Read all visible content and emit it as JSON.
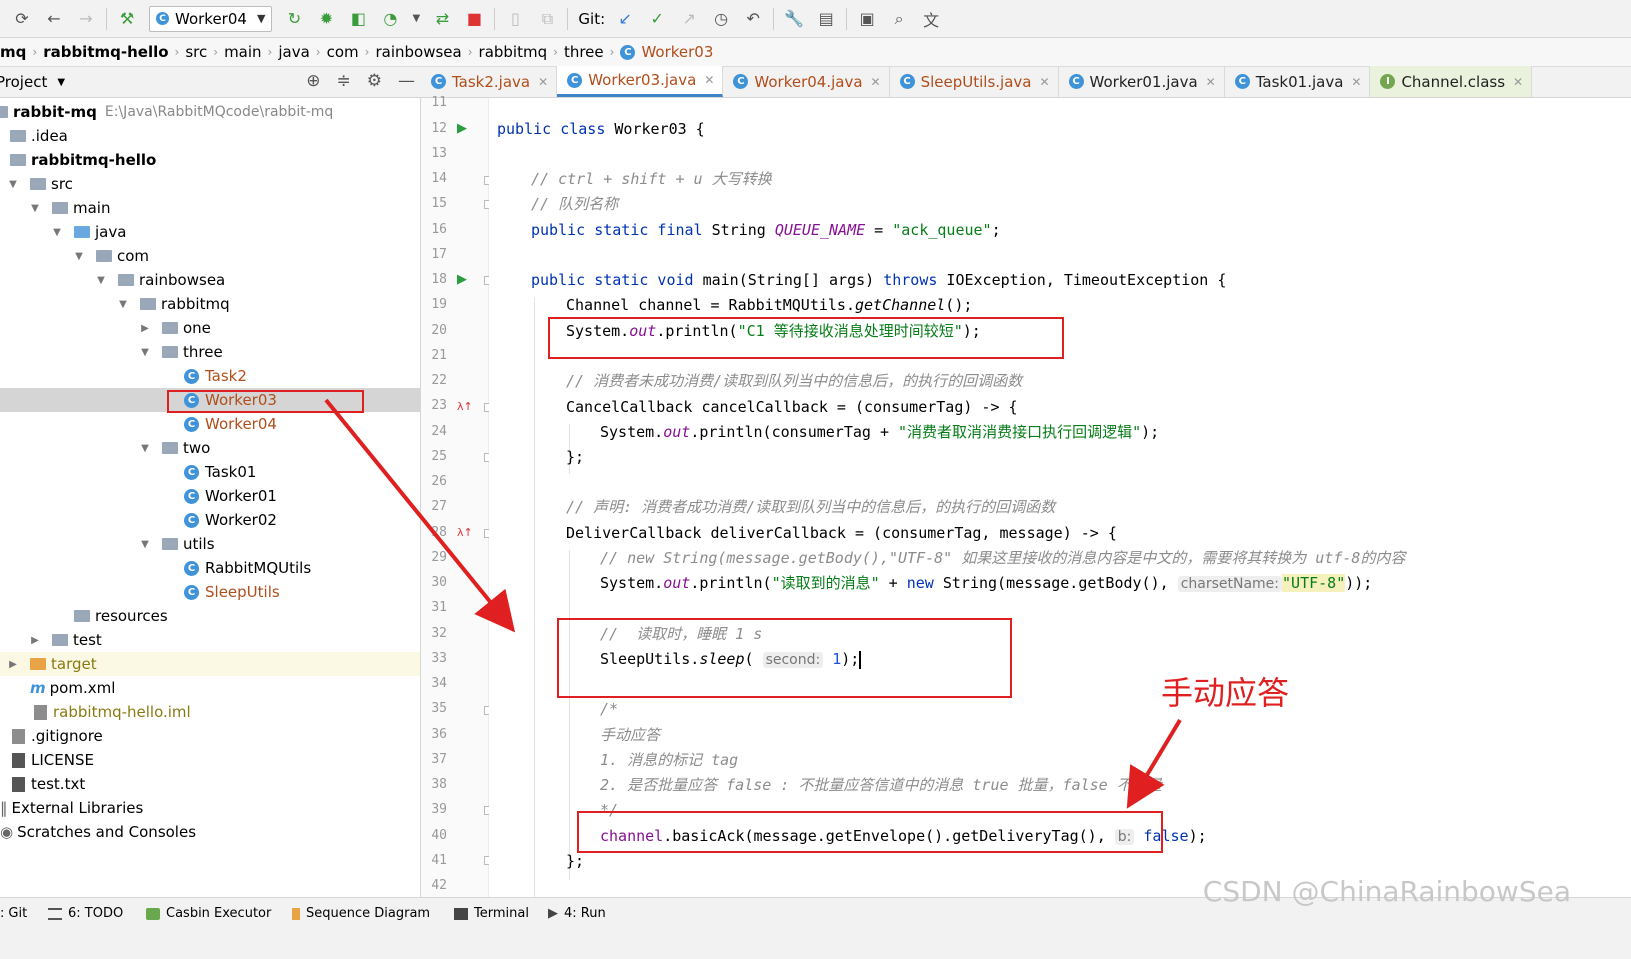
{
  "toolbar": {
    "run_config": "Worker04",
    "git_label": "Git:"
  },
  "breadcrumb": [
    "mq",
    "rabbitmq-hello",
    "src",
    "main",
    "java",
    "com",
    "rainbowsea",
    "rabbitmq",
    "three",
    "Worker03"
  ],
  "project_panel": {
    "title": "Project"
  },
  "tree": [
    {
      "label": "rabbit-mq",
      "path": "E:\\Java\\RabbitMQcode\\rabbit-mq",
      "bold": true
    },
    {
      "label": ".idea"
    },
    {
      "label": "rabbitmq-hello",
      "bold": true
    },
    {
      "label": "src"
    },
    {
      "label": "main"
    },
    {
      "label": "java"
    },
    {
      "label": "com"
    },
    {
      "label": "rainbowsea"
    },
    {
      "label": "rabbitmq"
    },
    {
      "label": "one"
    },
    {
      "label": "three"
    },
    {
      "label": "Task2"
    },
    {
      "label": "Worker03"
    },
    {
      "label": "Worker04"
    },
    {
      "label": "two"
    },
    {
      "label": "Task01"
    },
    {
      "label": "Worker01"
    },
    {
      "label": "Worker02"
    },
    {
      "label": "utils"
    },
    {
      "label": "RabbitMQUtils"
    },
    {
      "label": "SleepUtils"
    },
    {
      "label": "resources"
    },
    {
      "label": "test"
    },
    {
      "label": "target"
    },
    {
      "label": "pom.xml"
    },
    {
      "label": "rabbitmq-hello.iml"
    },
    {
      "label": ".gitignore"
    },
    {
      "label": "LICENSE"
    },
    {
      "label": "test.txt"
    },
    {
      "label": "External Libraries"
    },
    {
      "label": "Scratches and Consoles"
    }
  ],
  "tabs": [
    "Task2.java",
    "Worker03.java",
    "Worker04.java",
    "SleepUtils.java",
    "Worker01.java",
    "Task01.java",
    "Channel.class"
  ],
  "line_numbers": [
    "11",
    "12",
    "13",
    "14",
    "15",
    "16",
    "17",
    "18",
    "19",
    "20",
    "21",
    "22",
    "23",
    "24",
    "25",
    "26",
    "27",
    "28",
    "29",
    "30",
    "31",
    "32",
    "33",
    "34",
    "35",
    "36",
    "37",
    "38",
    "39",
    "40",
    "41",
    "42"
  ],
  "code": {
    "l12": {
      "kw1": "public class",
      "rest": " Worker03 {"
    },
    "l14": "// ctrl + shift + u 大写转换",
    "l15": "// 队列名称",
    "l16": {
      "kw": "public static final",
      "type": " String ",
      "field": "QUEUE_NAME",
      "eq": " = ",
      "str": "\"ack_queue\"",
      "end": ";"
    },
    "l18": {
      "kw": "public static void",
      "mid": " main(String[] args) ",
      "kw2": "throws",
      "rest": " IOException, TimeoutException {"
    },
    "l19": {
      "pre": "Channel channel = RabbitMQUtils.",
      "it": "getChannel",
      "post": "();"
    },
    "l20": {
      "pre": "System.",
      "fld": "out",
      "mid": ".println(",
      "str": "\"C1 等待接收消息处理时间较短\"",
      "end": ");"
    },
    "l22": "// 消费者未成功消费/读取到队列当中的信息后，的执行的回调函数",
    "l23": "CancelCallback cancelCallback = (consumerTag) -> {",
    "l24": {
      "pre": "System.",
      "fld": "out",
      "mid": ".println(consumerTag + ",
      "str": "\"消费者取消消费接口执行回调逻辑\"",
      "end": ");"
    },
    "l25": "};",
    "l27": "// 声明: 消费者成功消费/读取到队列当中的信息后，的执行的回调函数",
    "l28": "DeliverCallback deliverCallback = (consumerTag, message) -> {",
    "l29": "// new String(message.getBody(),\"UTF-8\" 如果这里接收的消息内容是中文的，需要将其转换为 utf-8的内容",
    "l30": {
      "pre": "System.",
      "fld": "out",
      "mid": ".println(",
      "str": "\"读取到的消息\"",
      "plus": " + ",
      "kw": "new",
      "rest": " String(message.getBody(), ",
      "hint": "charsetName:",
      "str2": "\"UTF-8\"",
      "end": "));"
    },
    "l32": "//  读取时，睡眠 1 s",
    "l33": {
      "pre": "SleepUtils.",
      "it": "sleep",
      "open": "( ",
      "hint": "second:",
      "num": " 1",
      "end": ");"
    },
    "l35": "/*",
    "l36": "手动应答",
    "l37": "1. 消息的标记 tag",
    "l38": "2. 是否批量应答 false : 不批量应答信道中的消息 true 批量，false 不批量",
    "l39": "*/",
    "l40": {
      "fld": "channel",
      "mid": ".basicAck(message.getEnvelope().getDeliveryTag(), ",
      "hint": "b:",
      "kw": " false",
      "end": ");"
    },
    "l41": "};"
  },
  "annotation": "手动应答",
  "status_bar": [
    "Git",
    "6: TODO",
    "Casbin Executor",
    "Sequence Diagram",
    "Terminal",
    "4: Run"
  ],
  "watermark": "CSDN @ChinaRainbowSea",
  "colors": {
    "accent": "#4083c9",
    "annotation_red": "#e02020",
    "keyword": "#0033b3",
    "string": "#067d17"
  }
}
